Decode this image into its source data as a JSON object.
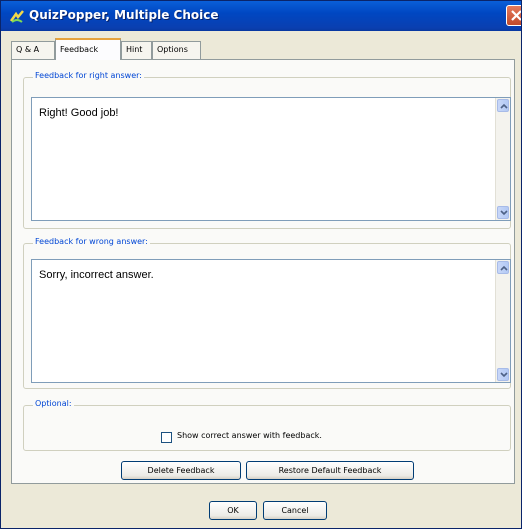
{
  "window": {
    "title": "QuizPopper, Multiple Choice",
    "app_icon": "quizpopper-app-icon",
    "close_icon": "close-icon"
  },
  "tabs": [
    {
      "label": "Q & A",
      "active": false
    },
    {
      "label": "Feedback",
      "active": true
    },
    {
      "label": "Hint",
      "active": false
    },
    {
      "label": "Options",
      "active": false
    }
  ],
  "right_feedback": {
    "legend": "Feedback for right answer:",
    "value": "Right! Good job!"
  },
  "wrong_feedback": {
    "legend": "Feedback for wrong answer:",
    "value": "Sorry, incorrect answer."
  },
  "optional": {
    "legend": "Optional:",
    "checkbox_label": "Show correct answer with feedback.",
    "checked": false
  },
  "buttons": {
    "delete_feedback": "Delete Feedback",
    "restore_default_feedback": "Restore Default Feedback",
    "ok": "OK",
    "cancel": "Cancel"
  },
  "colors": {
    "titlebar": "#0a4fd0",
    "legend_text": "#0046d5",
    "active_tab_accent": "#e6a23c",
    "close_button": "#d2543a"
  }
}
